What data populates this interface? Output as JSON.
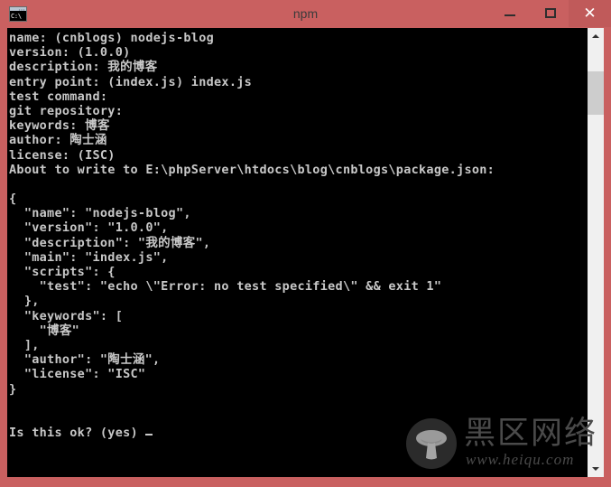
{
  "window": {
    "title": "npm",
    "app_icon_label": "C:\\",
    "accent_color": "#c96060",
    "close_button_color": "#c05a5a",
    "console_bg": "#000000",
    "console_fg": "#c8c8c8",
    "controls": {
      "minimize_label": "–",
      "maximize_label": "□",
      "close_label": "✕"
    }
  },
  "console": {
    "lines": [
      "name: (cnblogs) nodejs-blog",
      "version: (1.0.0)",
      "description: 我的博客",
      "entry point: (index.js) index.js",
      "test command:",
      "git repository:",
      "keywords: 博客",
      "author: 陶士涵",
      "license: (ISC)",
      "About to write to E:\\phpServer\\htdocs\\blog\\cnblogs\\package.json:",
      "",
      "{",
      "  \"name\": \"nodejs-blog\",",
      "  \"version\": \"1.0.0\",",
      "  \"description\": \"我的博客\",",
      "  \"main\": \"index.js\",",
      "  \"scripts\": {",
      "    \"test\": \"echo \\\"Error: no test specified\\\" && exit 1\"",
      "  },",
      "  \"keywords\": [",
      "    \"博客\"",
      "  ],",
      "  \"author\": \"陶士涵\",",
      "  \"license\": \"ISC\"",
      "}",
      "",
      "",
      "Is this ok? (yes)"
    ],
    "prompt_line": "Is this ok? (yes)",
    "cursor_visible": true
  },
  "scrollbar": {
    "up_arrow": "▲",
    "down_arrow": "▼",
    "track_color": "#f0f0f0",
    "thumb_color": "#cdcdcd"
  },
  "watermark": {
    "brand_cn": "黑区网络",
    "url": "www.heiqu.com"
  }
}
